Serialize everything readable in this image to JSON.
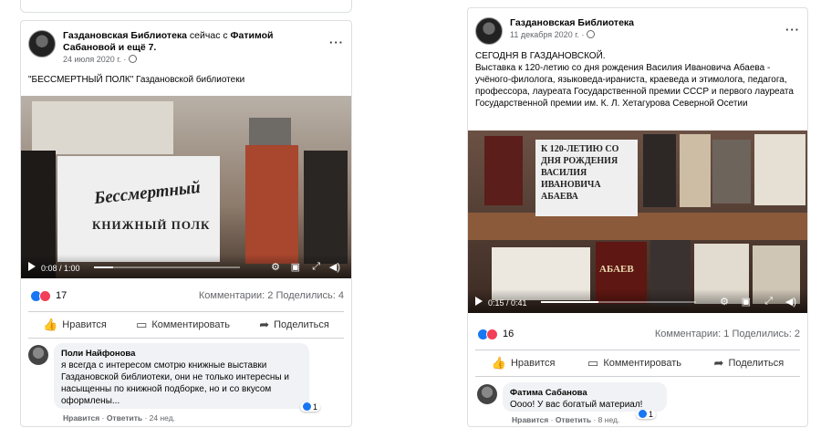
{
  "posts": [
    {
      "page_name": "Газдановская Библиотека",
      "header_rest": " сейчас с ",
      "tagged": "Фатимой Сабановой",
      "header_tail": " и ещё 7.",
      "date": "24 июля 2020 г. ·",
      "text": "\"БЕССМЕРТНЫЙ ПОЛК\" Газдановской библиотеки",
      "video": {
        "time": "0:08 / 1:00",
        "progress": 0.13,
        "banner_line1": "Бессмертный",
        "banner_line2": "КНИЖНЫЙ ПОЛК"
      },
      "reactions_count": "17",
      "comments_shares": "Комментарии: 2  Поделились: 4",
      "actions": {
        "like": "Нравится",
        "comment": "Комментировать",
        "share": "Поделиться"
      },
      "comment": {
        "author": "Поли Найфонова",
        "text": "я всегда с интересом смотрю книжные выставки Газдановской библиотеки, они не только интересны и насыщенны по книжной подборке, но и со вкусом оформлены...",
        "like": "Нравится",
        "reply": "Ответить",
        "age": "24 нед.",
        "likes": "1"
      }
    },
    {
      "page_name": "Газдановская Библиотека",
      "date": "11 декабря 2020 г. ·",
      "text_line1": "СЕГОДНЯ В ГАЗДАНОВСКОЙ.",
      "text_body": "Выставка к 120-летию со дня рождения Василия Ивановича Абаева - учёного-филолога, языковеда-ираниста, краеведа и этимолога, педагога, профессора, лауреата Государственной премии СССР и первого лауреата Государственной премии им. К. Л. Хетагурова Северной Осетии",
      "video": {
        "time": "0:15 / 0:41",
        "progress": 0.37,
        "banner": "К 120-ЛЕТИЮ СО ДНЯ РОЖДЕНИЯ ВАСИЛИЯ ИВАНОВИЧА АБАЕВА",
        "book_title": "АБАЕВ"
      },
      "reactions_count": "16",
      "comments_shares": "Комментарии: 1  Поделились: 2",
      "actions": {
        "like": "Нравится",
        "comment": "Комментировать",
        "share": "Поделиться"
      },
      "comment": {
        "author": "Фатима Сабанова",
        "text": "Оооо! У вас богатый материал!",
        "like": "Нравится",
        "reply": "Ответить",
        "age": "8 нед.",
        "likes": "1"
      }
    }
  ],
  "icons": {
    "more": "···",
    "like": "👍",
    "comment": "▭",
    "share": "➦"
  },
  "colors": {
    "fb_blue": "#1877f2",
    "love_red": "#f33e58",
    "muted": "#65676b"
  }
}
